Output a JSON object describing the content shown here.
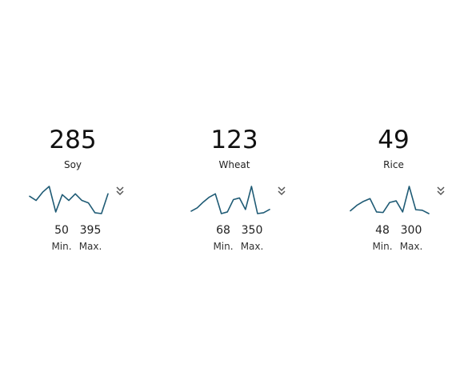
{
  "theme": {
    "line_color": "#1f5b75",
    "icon_color": "#555555"
  },
  "chart_data": [
    {
      "type": "line",
      "label": "Soy",
      "value": "285",
      "min": "50",
      "max": "395",
      "min_label": "Min.",
      "max_label": "Max.",
      "values": [
        230,
        205,
        255,
        290,
        135,
        240,
        205,
        245,
        205,
        190,
        130,
        125,
        245
      ]
    },
    {
      "type": "line",
      "label": "Wheat",
      "value": "123",
      "min": "68",
      "max": "350",
      "min_label": "Min.",
      "max_label": "Max.",
      "values": [
        140,
        160,
        195,
        225,
        245,
        125,
        135,
        210,
        220,
        150,
        290,
        125,
        130,
        150
      ]
    },
    {
      "type": "line",
      "label": "Rice",
      "value": "49",
      "min": "48",
      "max": "300",
      "min_label": "Min.",
      "max_label": "Max.",
      "values": [
        80,
        130,
        165,
        190,
        70,
        65,
        155,
        170,
        70,
        300,
        90,
        85,
        55
      ]
    }
  ]
}
